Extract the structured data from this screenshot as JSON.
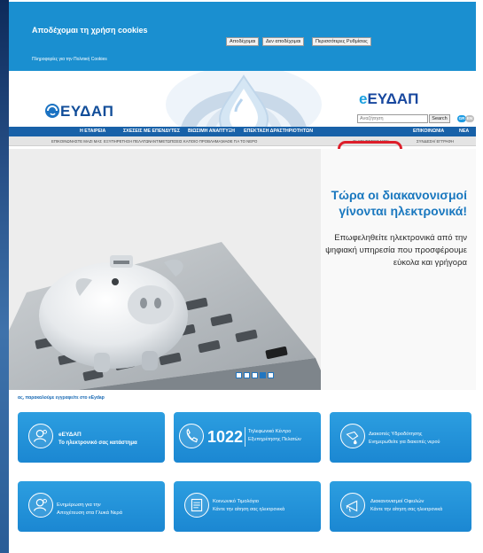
{
  "cookie_banner": {
    "title": "Αποδέχομαι τη χρήση cookies",
    "more_info_link": "Πληροφορίες για την Πολιτική Cookies",
    "buttons": {
      "accept": "Αποδέχομαι",
      "decline": "Δεν αποδέχομαι",
      "settings": "Περισσότερες Ρυθμίσεις"
    }
  },
  "header": {
    "logo_text": "ΕΥΔΑΠ",
    "eydap_prefix": "e",
    "eydap_rest": "ΕΥΔΑΠ",
    "search": {
      "placeholder": "Αναζήτηση",
      "button": "Search"
    },
    "languages": [
      "GR",
      "EN"
    ]
  },
  "nav_main": [
    "Η ΕΤΑΙΡΕΙΑ",
    "ΣΧΕΣΕΙΣ ΜΕ ΕΠΕΝΔΥΤΕΣ",
    "ΒΙΩΣΙΜΗ ΑΝΑΠΤΥΞΗ",
    "ΕΠΕΚΤΑΣΗ ΔΡΑΣΤΗΡΙΟΤΗΤΩΝ",
    "ΕΠΙΚΟΙΝΩΝΙΑ",
    "ΝΕΑ"
  ],
  "nav_sub": [
    "ΕΠΙΚΟΙΝΩΝΗΣΤΕ ΜΑΖΙ ΜΑΣ",
    "ΕΞΥΠΗΡΕΤΗΣΗ ΠΕΛΑΤΩΝ",
    "ΑΝΤΙΜΕΤΩΠΙΣΕΙΣ ΚΑΠΟΙΟ ΠΡΟΒΛΗΜΑ;",
    "ΜΑΘΕ ΓΙΑ ΤΟ ΝΕΡΟ",
    "ΟΙ ΥΠΗΡΕΣΙΕΣ ΜΟΥ",
    "ΣΥΝΔΕΣΗ/ ΕΓΓΡΑΦΗ"
  ],
  "banner": {
    "headline_1": "Τώρα οι διακανονισμοί",
    "headline_2": "γίνονται ηλεκτρονικά!",
    "body_1": "Επωφεληθείτε ηλεκτρονικά από την",
    "body_2": "ψηφιακή υπηρεσία που προσφέρουμε",
    "body_3": "εύκολα και γρήγορα",
    "slides_total": 5,
    "active_slide": 4
  },
  "register_note": "ας, παρακαλούμε εγγραφείτε στο eEydap",
  "tiles": [
    {
      "title": "eΕΥΔΑΠ",
      "subtitle": "Το ηλεκτρονικό σας κατάστημα",
      "icon": "person-icon"
    },
    {
      "number": "1022",
      "title": "Τηλεφωνικό Κέντρο",
      "subtitle": "Εξυπηρέτησης Πελατών",
      "icon": "phone-icon"
    },
    {
      "title": "Διακοπές Υδροδότησης",
      "subtitle": "Ενημερωθείτε για διακοπές νερού",
      "icon": "water-tap-icon"
    },
    {
      "title": "Ενημέρωση για την",
      "subtitle": "Αποχέτευση στα Γλυκά Νερά",
      "icon": "person-icon"
    },
    {
      "title": "Κοινωνικό Τιμολόγιο",
      "subtitle": "Κάντε την αίτηση σας ηλεκτρονικά",
      "icon": "document-icon"
    },
    {
      "title": "Διακανονισμοί Οφειλών",
      "subtitle": "Κάντε την αίτηση σας ηλεκτρονικά",
      "icon": "megaphone-icon"
    }
  ],
  "colors": {
    "brand_blue": "#1861a8",
    "light_blue": "#1a8fd0",
    "highlight_red": "#dd1e2a"
  }
}
